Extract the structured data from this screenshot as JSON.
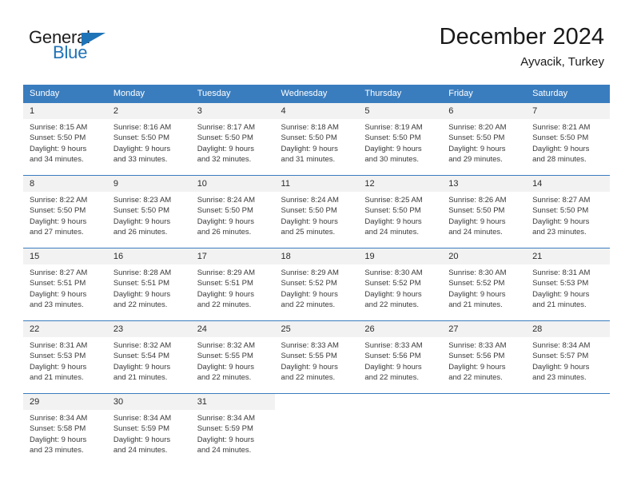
{
  "brand": {
    "name_part1": "General",
    "name_part2": "Blue",
    "accent_color": "#1f73b7"
  },
  "header": {
    "title": "December 2024",
    "subtitle": "Ayvacik, Turkey"
  },
  "theme": {
    "header_bg": "#3a7dbf",
    "daynum_bg": "#f2f2f2",
    "text_color": "#3a3a3a"
  },
  "weekday_headers": [
    "Sunday",
    "Monday",
    "Tuesday",
    "Wednesday",
    "Thursday",
    "Friday",
    "Saturday"
  ],
  "weeks": [
    [
      {
        "day": "1",
        "sunrise": "Sunrise: 8:15 AM",
        "sunset": "Sunset: 5:50 PM",
        "daylight1": "Daylight: 9 hours",
        "daylight2": "and 34 minutes."
      },
      {
        "day": "2",
        "sunrise": "Sunrise: 8:16 AM",
        "sunset": "Sunset: 5:50 PM",
        "daylight1": "Daylight: 9 hours",
        "daylight2": "and 33 minutes."
      },
      {
        "day": "3",
        "sunrise": "Sunrise: 8:17 AM",
        "sunset": "Sunset: 5:50 PM",
        "daylight1": "Daylight: 9 hours",
        "daylight2": "and 32 minutes."
      },
      {
        "day": "4",
        "sunrise": "Sunrise: 8:18 AM",
        "sunset": "Sunset: 5:50 PM",
        "daylight1": "Daylight: 9 hours",
        "daylight2": "and 31 minutes."
      },
      {
        "day": "5",
        "sunrise": "Sunrise: 8:19 AM",
        "sunset": "Sunset: 5:50 PM",
        "daylight1": "Daylight: 9 hours",
        "daylight2": "and 30 minutes."
      },
      {
        "day": "6",
        "sunrise": "Sunrise: 8:20 AM",
        "sunset": "Sunset: 5:50 PM",
        "daylight1": "Daylight: 9 hours",
        "daylight2": "and 29 minutes."
      },
      {
        "day": "7",
        "sunrise": "Sunrise: 8:21 AM",
        "sunset": "Sunset: 5:50 PM",
        "daylight1": "Daylight: 9 hours",
        "daylight2": "and 28 minutes."
      }
    ],
    [
      {
        "day": "8",
        "sunrise": "Sunrise: 8:22 AM",
        "sunset": "Sunset: 5:50 PM",
        "daylight1": "Daylight: 9 hours",
        "daylight2": "and 27 minutes."
      },
      {
        "day": "9",
        "sunrise": "Sunrise: 8:23 AM",
        "sunset": "Sunset: 5:50 PM",
        "daylight1": "Daylight: 9 hours",
        "daylight2": "and 26 minutes."
      },
      {
        "day": "10",
        "sunrise": "Sunrise: 8:24 AM",
        "sunset": "Sunset: 5:50 PM",
        "daylight1": "Daylight: 9 hours",
        "daylight2": "and 26 minutes."
      },
      {
        "day": "11",
        "sunrise": "Sunrise: 8:24 AM",
        "sunset": "Sunset: 5:50 PM",
        "daylight1": "Daylight: 9 hours",
        "daylight2": "and 25 minutes."
      },
      {
        "day": "12",
        "sunrise": "Sunrise: 8:25 AM",
        "sunset": "Sunset: 5:50 PM",
        "daylight1": "Daylight: 9 hours",
        "daylight2": "and 24 minutes."
      },
      {
        "day": "13",
        "sunrise": "Sunrise: 8:26 AM",
        "sunset": "Sunset: 5:50 PM",
        "daylight1": "Daylight: 9 hours",
        "daylight2": "and 24 minutes."
      },
      {
        "day": "14",
        "sunrise": "Sunrise: 8:27 AM",
        "sunset": "Sunset: 5:50 PM",
        "daylight1": "Daylight: 9 hours",
        "daylight2": "and 23 minutes."
      }
    ],
    [
      {
        "day": "15",
        "sunrise": "Sunrise: 8:27 AM",
        "sunset": "Sunset: 5:51 PM",
        "daylight1": "Daylight: 9 hours",
        "daylight2": "and 23 minutes."
      },
      {
        "day": "16",
        "sunrise": "Sunrise: 8:28 AM",
        "sunset": "Sunset: 5:51 PM",
        "daylight1": "Daylight: 9 hours",
        "daylight2": "and 22 minutes."
      },
      {
        "day": "17",
        "sunrise": "Sunrise: 8:29 AM",
        "sunset": "Sunset: 5:51 PM",
        "daylight1": "Daylight: 9 hours",
        "daylight2": "and 22 minutes."
      },
      {
        "day": "18",
        "sunrise": "Sunrise: 8:29 AM",
        "sunset": "Sunset: 5:52 PM",
        "daylight1": "Daylight: 9 hours",
        "daylight2": "and 22 minutes."
      },
      {
        "day": "19",
        "sunrise": "Sunrise: 8:30 AM",
        "sunset": "Sunset: 5:52 PM",
        "daylight1": "Daylight: 9 hours",
        "daylight2": "and 22 minutes."
      },
      {
        "day": "20",
        "sunrise": "Sunrise: 8:30 AM",
        "sunset": "Sunset: 5:52 PM",
        "daylight1": "Daylight: 9 hours",
        "daylight2": "and 21 minutes."
      },
      {
        "day": "21",
        "sunrise": "Sunrise: 8:31 AM",
        "sunset": "Sunset: 5:53 PM",
        "daylight1": "Daylight: 9 hours",
        "daylight2": "and 21 minutes."
      }
    ],
    [
      {
        "day": "22",
        "sunrise": "Sunrise: 8:31 AM",
        "sunset": "Sunset: 5:53 PM",
        "daylight1": "Daylight: 9 hours",
        "daylight2": "and 21 minutes."
      },
      {
        "day": "23",
        "sunrise": "Sunrise: 8:32 AM",
        "sunset": "Sunset: 5:54 PM",
        "daylight1": "Daylight: 9 hours",
        "daylight2": "and 21 minutes."
      },
      {
        "day": "24",
        "sunrise": "Sunrise: 8:32 AM",
        "sunset": "Sunset: 5:55 PM",
        "daylight1": "Daylight: 9 hours",
        "daylight2": "and 22 minutes."
      },
      {
        "day": "25",
        "sunrise": "Sunrise: 8:33 AM",
        "sunset": "Sunset: 5:55 PM",
        "daylight1": "Daylight: 9 hours",
        "daylight2": "and 22 minutes."
      },
      {
        "day": "26",
        "sunrise": "Sunrise: 8:33 AM",
        "sunset": "Sunset: 5:56 PM",
        "daylight1": "Daylight: 9 hours",
        "daylight2": "and 22 minutes."
      },
      {
        "day": "27",
        "sunrise": "Sunrise: 8:33 AM",
        "sunset": "Sunset: 5:56 PM",
        "daylight1": "Daylight: 9 hours",
        "daylight2": "and 22 minutes."
      },
      {
        "day": "28",
        "sunrise": "Sunrise: 8:34 AM",
        "sunset": "Sunset: 5:57 PM",
        "daylight1": "Daylight: 9 hours",
        "daylight2": "and 23 minutes."
      }
    ],
    [
      {
        "day": "29",
        "sunrise": "Sunrise: 8:34 AM",
        "sunset": "Sunset: 5:58 PM",
        "daylight1": "Daylight: 9 hours",
        "daylight2": "and 23 minutes."
      },
      {
        "day": "30",
        "sunrise": "Sunrise: 8:34 AM",
        "sunset": "Sunset: 5:59 PM",
        "daylight1": "Daylight: 9 hours",
        "daylight2": "and 24 minutes."
      },
      {
        "day": "31",
        "sunrise": "Sunrise: 8:34 AM",
        "sunset": "Sunset: 5:59 PM",
        "daylight1": "Daylight: 9 hours",
        "daylight2": "and 24 minutes."
      },
      {
        "day": "",
        "sunrise": "",
        "sunset": "",
        "daylight1": "",
        "daylight2": ""
      },
      {
        "day": "",
        "sunrise": "",
        "sunset": "",
        "daylight1": "",
        "daylight2": ""
      },
      {
        "day": "",
        "sunrise": "",
        "sunset": "",
        "daylight1": "",
        "daylight2": ""
      },
      {
        "day": "",
        "sunrise": "",
        "sunset": "",
        "daylight1": "",
        "daylight2": ""
      }
    ]
  ]
}
